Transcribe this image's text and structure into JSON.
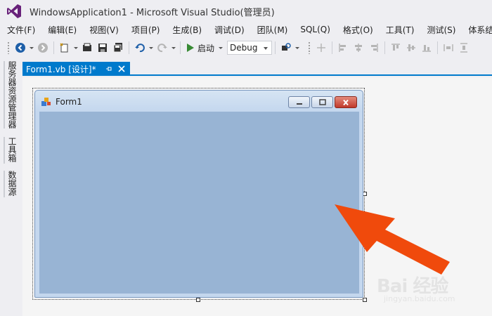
{
  "window": {
    "title": "WindowsApplication1 - Microsoft Visual Studio(管理员)"
  },
  "menu": [
    {
      "label": "文件(F)"
    },
    {
      "label": "编辑(E)"
    },
    {
      "label": "视图(V)"
    },
    {
      "label": "项目(P)"
    },
    {
      "label": "生成(B)"
    },
    {
      "label": "调试(D)"
    },
    {
      "label": "团队(M)"
    },
    {
      "label": "SQL(Q)"
    },
    {
      "label": "格式(O)"
    },
    {
      "label": "工具(T)"
    },
    {
      "label": "测试(S)"
    },
    {
      "label": "体系结构"
    }
  ],
  "toolbar": {
    "start_label": "启动",
    "configuration": "Debug"
  },
  "sidebar": {
    "tabs": [
      {
        "label": "服务器资源管理器"
      },
      {
        "label": "工具箱"
      },
      {
        "label": "数据源"
      }
    ]
  },
  "document_tab": {
    "label": "Form1.vb [设计]*"
  },
  "form": {
    "title": "Form1"
  },
  "watermark": {
    "main": "Bai 经验",
    "sub": "jingyan.baidu.com"
  },
  "colors": {
    "accent": "#007acc",
    "form_client": "#98b4d4",
    "arrow": "#f04a0c",
    "chrome": "#eeeef2"
  }
}
